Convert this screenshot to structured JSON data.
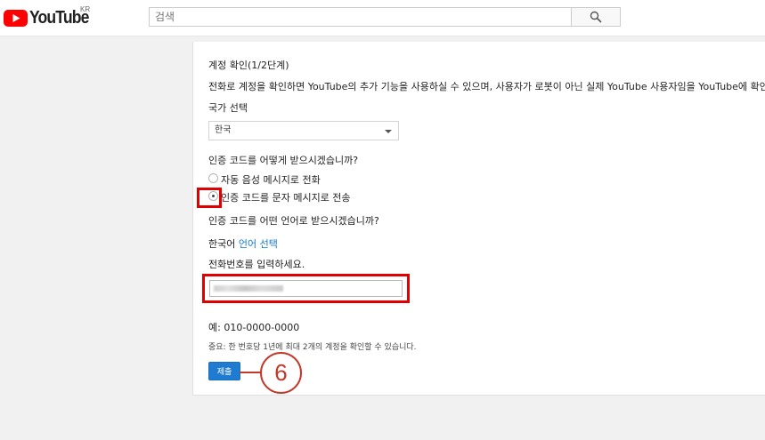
{
  "header": {
    "logo_text": "YouTube",
    "country": "KR",
    "search_placeholder": "검색"
  },
  "form": {
    "title": "계정 확인(1/2단계)",
    "description": "전화로 계정을 확인하면 YouTube의 추가 기능을 사용하실 수 있으며, 사용자가 로봇이 아닌 실제 YouTube 사용자임을 YouTube에 확인시",
    "country_label": "국가 선택",
    "country_value": "한국",
    "method_question": "인증 코드를 어떻게 받으시겠습니까?",
    "method_options": [
      {
        "label": "자동 음성 메시지로 전화",
        "checked": false
      },
      {
        "label": "인증 코드를 문자 메시지로 전송",
        "checked": true
      }
    ],
    "language_question": "인증 코드를 어떤 언어로 받으시겠습니까?",
    "language_value": "한국어",
    "language_link": "언어 선택",
    "phone_label": "전화번호를 입력하세요.",
    "example": "예: 010-0000-0000",
    "note": "중요: 한 번호당 1년에 최대 2개의 계정을 확인할 수 있습니다.",
    "submit_label": "제출"
  },
  "annotation": {
    "step_number": "6",
    "highlight_color": "#e00000",
    "step_color": "#c0392b"
  },
  "colors": {
    "brand_red": "#ff0000",
    "submit_blue": "#1f7bd0",
    "link_blue": "#167ac6"
  }
}
